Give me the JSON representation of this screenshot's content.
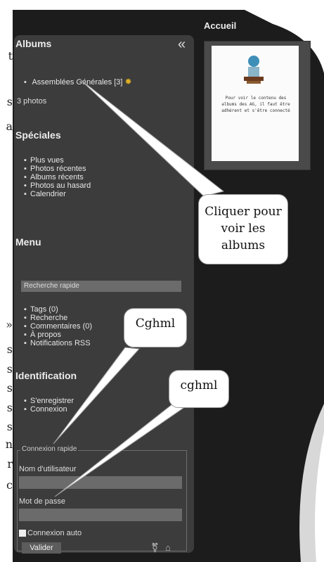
{
  "edge_letters": [
    "t",
    "s",
    "a",
    "»",
    "s",
    "s",
    "s",
    "s",
    "s",
    "n",
    "r",
    "c"
  ],
  "header": {
    "title": "Accueil"
  },
  "sidebar": {
    "collapse_icon": "«",
    "albums": {
      "title": "Albums",
      "items": [
        {
          "label": "Assemblées Générales",
          "count": "[3]",
          "icon": "new-sun-icon"
        }
      ],
      "photo_count": "3 photos"
    },
    "speciales": {
      "title": "Spéciales",
      "items": [
        "Plus vues",
        "Photos récentes",
        "Albums récents",
        "Photos au hasard",
        "Calendrier"
      ]
    },
    "menu": {
      "title": "Menu",
      "search_label": "Recherche rapide",
      "items": [
        "Tags (0)",
        "Recherche",
        "Commentaires (0)",
        "À propos",
        "Notifications RSS"
      ]
    },
    "identification": {
      "title": "Identification",
      "items": [
        "S'enregistrer",
        "Connexion"
      ]
    },
    "quick_login": {
      "legend": "Connexion rapide",
      "username_label": "Nom d'utilisateur",
      "password_label": "Mot de passe",
      "auto_label": "Connexion auto",
      "submit_label": "Valider"
    }
  },
  "thumbnail": {
    "text": "Pour voir le contenu des albums des AG, il faut être adhérent et s'être connecté"
  },
  "annotations": {
    "albums_hint": [
      "Cliquer pour",
      "voir les",
      "albums"
    ],
    "username_hint": "Cghml",
    "password_hint": "cghml"
  }
}
